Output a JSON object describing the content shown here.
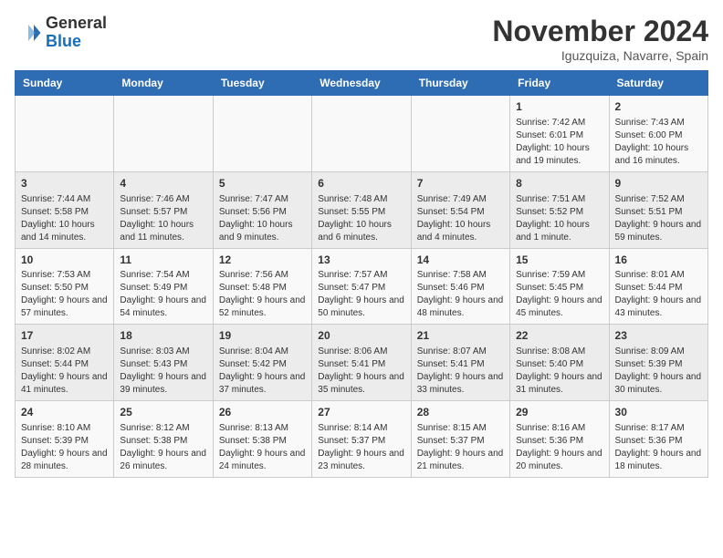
{
  "logo": {
    "general": "General",
    "blue": "Blue"
  },
  "title": "November 2024",
  "location": "Iguzquiza, Navarre, Spain",
  "days_header": [
    "Sunday",
    "Monday",
    "Tuesday",
    "Wednesday",
    "Thursday",
    "Friday",
    "Saturday"
  ],
  "weeks": [
    [
      {
        "day": "",
        "info": ""
      },
      {
        "day": "",
        "info": ""
      },
      {
        "day": "",
        "info": ""
      },
      {
        "day": "",
        "info": ""
      },
      {
        "day": "",
        "info": ""
      },
      {
        "day": "1",
        "info": "Sunrise: 7:42 AM\nSunset: 6:01 PM\nDaylight: 10 hours and 19 minutes."
      },
      {
        "day": "2",
        "info": "Sunrise: 7:43 AM\nSunset: 6:00 PM\nDaylight: 10 hours and 16 minutes."
      }
    ],
    [
      {
        "day": "3",
        "info": "Sunrise: 7:44 AM\nSunset: 5:58 PM\nDaylight: 10 hours and 14 minutes."
      },
      {
        "day": "4",
        "info": "Sunrise: 7:46 AM\nSunset: 5:57 PM\nDaylight: 10 hours and 11 minutes."
      },
      {
        "day": "5",
        "info": "Sunrise: 7:47 AM\nSunset: 5:56 PM\nDaylight: 10 hours and 9 minutes."
      },
      {
        "day": "6",
        "info": "Sunrise: 7:48 AM\nSunset: 5:55 PM\nDaylight: 10 hours and 6 minutes."
      },
      {
        "day": "7",
        "info": "Sunrise: 7:49 AM\nSunset: 5:54 PM\nDaylight: 10 hours and 4 minutes."
      },
      {
        "day": "8",
        "info": "Sunrise: 7:51 AM\nSunset: 5:52 PM\nDaylight: 10 hours and 1 minute."
      },
      {
        "day": "9",
        "info": "Sunrise: 7:52 AM\nSunset: 5:51 PM\nDaylight: 9 hours and 59 minutes."
      }
    ],
    [
      {
        "day": "10",
        "info": "Sunrise: 7:53 AM\nSunset: 5:50 PM\nDaylight: 9 hours and 57 minutes."
      },
      {
        "day": "11",
        "info": "Sunrise: 7:54 AM\nSunset: 5:49 PM\nDaylight: 9 hours and 54 minutes."
      },
      {
        "day": "12",
        "info": "Sunrise: 7:56 AM\nSunset: 5:48 PM\nDaylight: 9 hours and 52 minutes."
      },
      {
        "day": "13",
        "info": "Sunrise: 7:57 AM\nSunset: 5:47 PM\nDaylight: 9 hours and 50 minutes."
      },
      {
        "day": "14",
        "info": "Sunrise: 7:58 AM\nSunset: 5:46 PM\nDaylight: 9 hours and 48 minutes."
      },
      {
        "day": "15",
        "info": "Sunrise: 7:59 AM\nSunset: 5:45 PM\nDaylight: 9 hours and 45 minutes."
      },
      {
        "day": "16",
        "info": "Sunrise: 8:01 AM\nSunset: 5:44 PM\nDaylight: 9 hours and 43 minutes."
      }
    ],
    [
      {
        "day": "17",
        "info": "Sunrise: 8:02 AM\nSunset: 5:44 PM\nDaylight: 9 hours and 41 minutes."
      },
      {
        "day": "18",
        "info": "Sunrise: 8:03 AM\nSunset: 5:43 PM\nDaylight: 9 hours and 39 minutes."
      },
      {
        "day": "19",
        "info": "Sunrise: 8:04 AM\nSunset: 5:42 PM\nDaylight: 9 hours and 37 minutes."
      },
      {
        "day": "20",
        "info": "Sunrise: 8:06 AM\nSunset: 5:41 PM\nDaylight: 9 hours and 35 minutes."
      },
      {
        "day": "21",
        "info": "Sunrise: 8:07 AM\nSunset: 5:41 PM\nDaylight: 9 hours and 33 minutes."
      },
      {
        "day": "22",
        "info": "Sunrise: 8:08 AM\nSunset: 5:40 PM\nDaylight: 9 hours and 31 minutes."
      },
      {
        "day": "23",
        "info": "Sunrise: 8:09 AM\nSunset: 5:39 PM\nDaylight: 9 hours and 30 minutes."
      }
    ],
    [
      {
        "day": "24",
        "info": "Sunrise: 8:10 AM\nSunset: 5:39 PM\nDaylight: 9 hours and 28 minutes."
      },
      {
        "day": "25",
        "info": "Sunrise: 8:12 AM\nSunset: 5:38 PM\nDaylight: 9 hours and 26 minutes."
      },
      {
        "day": "26",
        "info": "Sunrise: 8:13 AM\nSunset: 5:38 PM\nDaylight: 9 hours and 24 minutes."
      },
      {
        "day": "27",
        "info": "Sunrise: 8:14 AM\nSunset: 5:37 PM\nDaylight: 9 hours and 23 minutes."
      },
      {
        "day": "28",
        "info": "Sunrise: 8:15 AM\nSunset: 5:37 PM\nDaylight: 9 hours and 21 minutes."
      },
      {
        "day": "29",
        "info": "Sunrise: 8:16 AM\nSunset: 5:36 PM\nDaylight: 9 hours and 20 minutes."
      },
      {
        "day": "30",
        "info": "Sunrise: 8:17 AM\nSunset: 5:36 PM\nDaylight: 9 hours and 18 minutes."
      }
    ]
  ]
}
